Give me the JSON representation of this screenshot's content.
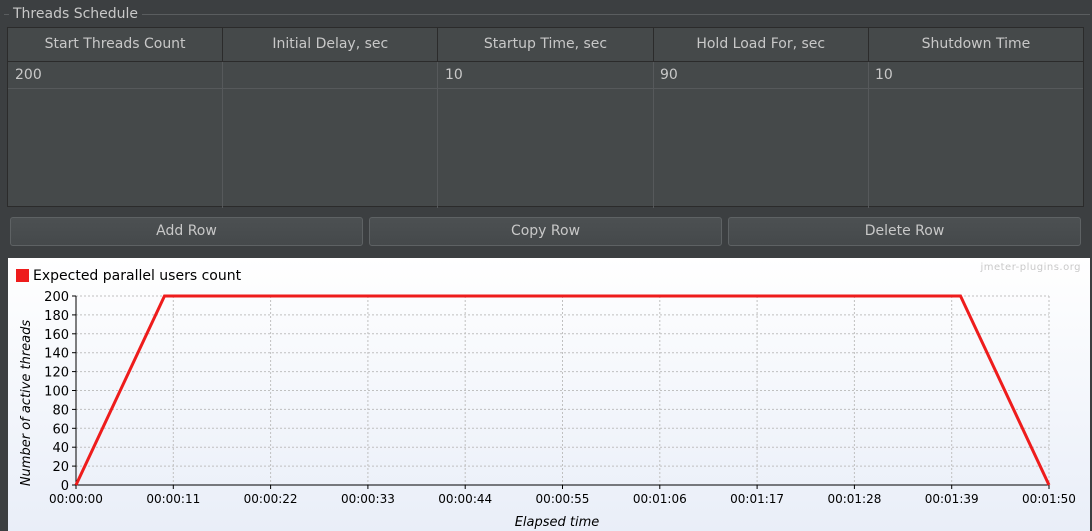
{
  "panel": {
    "title": "Threads Schedule"
  },
  "table": {
    "columns": [
      "Start Threads Count",
      "Initial Delay, sec",
      "Startup Time, sec",
      "Hold Load For, sec",
      "Shutdown Time"
    ],
    "rows": [
      [
        "200",
        "",
        "10",
        "90",
        "10"
      ]
    ]
  },
  "buttons": {
    "add": "Add Row",
    "copy": "Copy Row",
    "delete": "Delete Row"
  },
  "chart": {
    "watermark": "jmeter-plugins.org",
    "line_color": "#ee1c1c"
  },
  "chart_data": {
    "type": "line",
    "title": "",
    "xlabel": "Elapsed time",
    "ylabel": "Number of active threads",
    "ylim": [
      0,
      200
    ],
    "xlim_seconds": [
      0,
      110
    ],
    "yticks": [
      0,
      20,
      40,
      60,
      80,
      100,
      120,
      140,
      160,
      180,
      200
    ],
    "xticks": [
      "00:00:00",
      "00:00:11",
      "00:00:22",
      "00:00:33",
      "00:00:44",
      "00:00:55",
      "00:01:06",
      "00:01:17",
      "00:01:28",
      "00:01:39",
      "00:01:50"
    ],
    "grid": true,
    "legend": "top-left",
    "series": [
      {
        "name": "Expected parallel users count",
        "x_seconds": [
          0,
          10,
          100,
          110
        ],
        "x": [
          "00:00:00",
          "00:00:10",
          "00:01:40",
          "00:01:50"
        ],
        "y": [
          0,
          200,
          200,
          0
        ]
      }
    ]
  }
}
